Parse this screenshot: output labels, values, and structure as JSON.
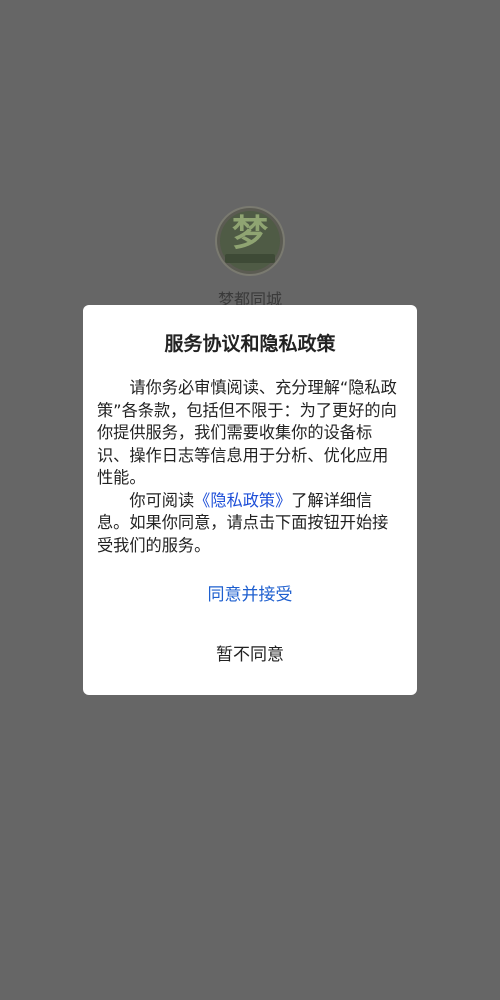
{
  "app": {
    "name": "梦都同城",
    "logo_glyph": "梦"
  },
  "dialog": {
    "title": "服务协议和隐私政策",
    "paragraph1": "请你务必审慎阅读、充分理解“隐私政策”各条款，包括但不限于：为了更好的向你提供服务，我们需要收集你的设备标识、操作日志等信息用于分析、优化应用性能。",
    "paragraph2_before": "你可阅读",
    "paragraph2_link": "《隐私政策》",
    "paragraph2_after": "了解详细信息。如果你同意，请点击下面按钮开始接受我们的服务。",
    "accept_label": "同意并接受",
    "decline_label": "暂不同意"
  },
  "colors": {
    "overlay": "#666666",
    "dialog_bg": "#ffffff",
    "link": "#1e4fd8",
    "accept": "#1e5fcf"
  }
}
